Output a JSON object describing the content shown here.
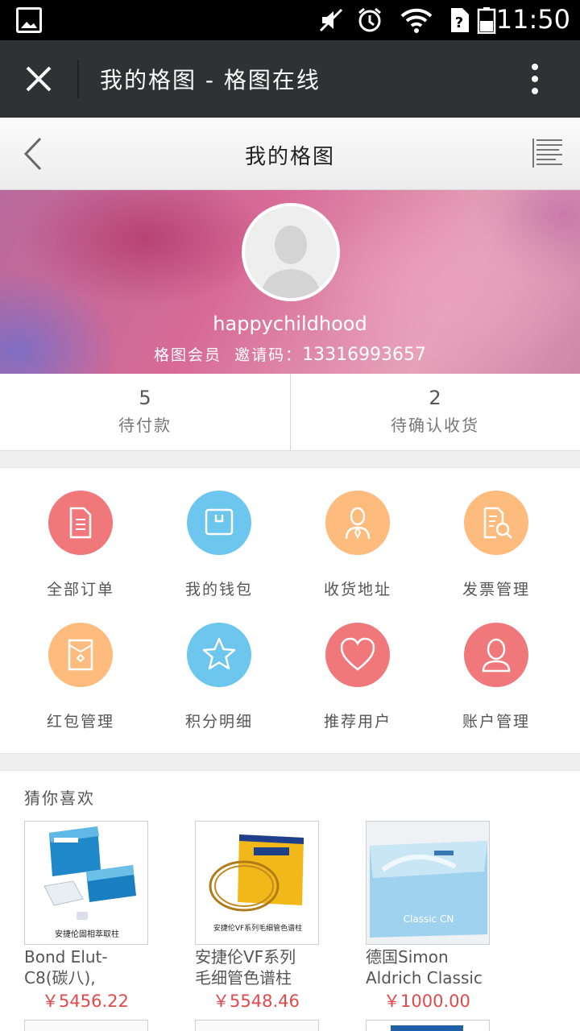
{
  "status": {
    "time": "11:50"
  },
  "titlebar": {
    "title": "我的格图 - 格图在线"
  },
  "nav": {
    "title": "我的格图"
  },
  "profile": {
    "username": "happychildhood",
    "member_label": "格图会员",
    "invite_label": "邀请码：",
    "invite_code": "13316993657"
  },
  "stats": [
    {
      "count": "5",
      "label": "待付款"
    },
    {
      "count": "2",
      "label": "待确认收货"
    }
  ],
  "menu": [
    {
      "label": "全部订单",
      "icon": "document-icon",
      "color": "#f0777a"
    },
    {
      "label": "我的钱包",
      "icon": "wallet-icon",
      "color": "#6cc6ee"
    },
    {
      "label": "收货地址",
      "icon": "person-tie-icon",
      "color": "#fdbb7d"
    },
    {
      "label": "发票管理",
      "icon": "invoice-search-icon",
      "color": "#fdbb7d"
    },
    {
      "label": "红包管理",
      "icon": "red-envelope-icon",
      "color": "#fdbb7d"
    },
    {
      "label": "积分明细",
      "icon": "star-icon",
      "color": "#6cc6ee"
    },
    {
      "label": "推荐用户",
      "icon": "heart-icon",
      "color": "#f0777a"
    },
    {
      "label": "账户管理",
      "icon": "user-icon",
      "color": "#f0777a"
    }
  ],
  "recommend": {
    "title": "猜你喜欢",
    "products": [
      {
        "name_line1": "Bond Elut-",
        "name_line2": "C8(碳八),",
        "price": "￥5456.22",
        "thumb_caption": "安捷伦固相萃取柱"
      },
      {
        "name_line1": "安捷伦VF系列",
        "name_line2": "毛细管色谱柱",
        "price": "￥5548.46",
        "thumb_caption": "安捷伦VF系列毛细管色谱柱"
      },
      {
        "name_line1": "德国Simon",
        "name_line2": "Aldrich Classic",
        "price": "￥1000.00",
        "thumb_caption": "Classic CN"
      }
    ]
  }
}
